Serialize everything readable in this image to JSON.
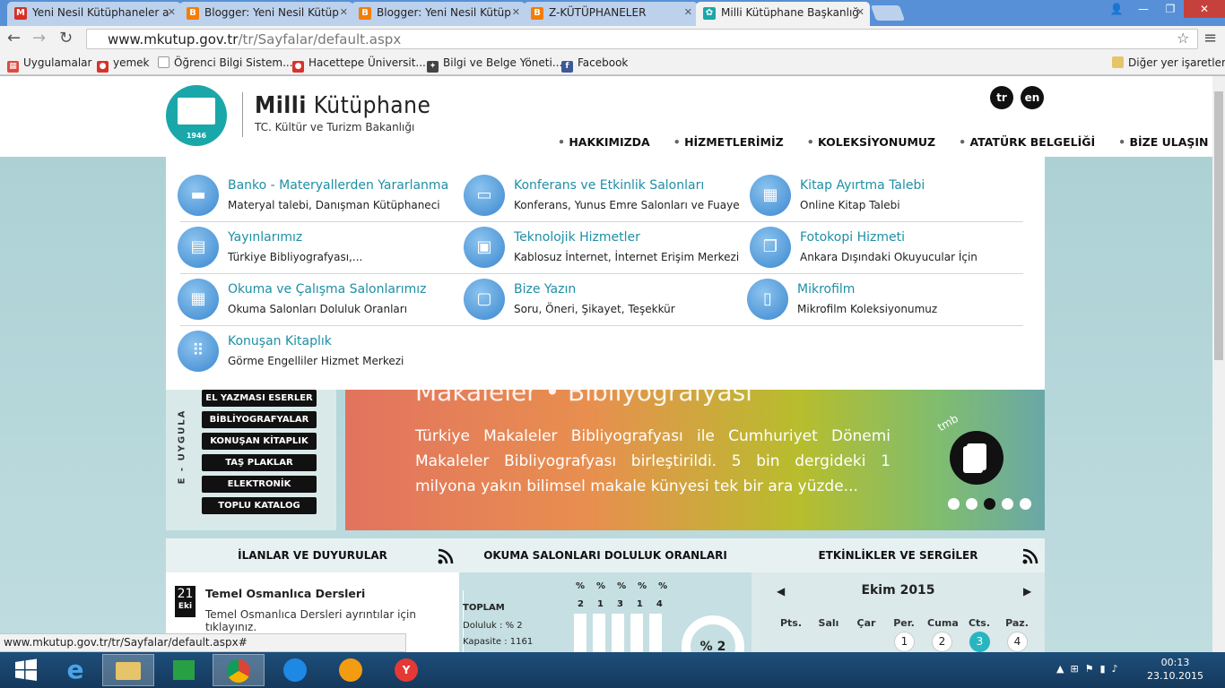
{
  "browser": {
    "tabs": [
      {
        "title": "Yeni Nesil Kütüphaneler a",
        "icon": "gmail-icon",
        "color": "#d93025"
      },
      {
        "title": "Blogger: Yeni Nesil Kütüp",
        "icon": "blogger-icon",
        "color": "#f57d00"
      },
      {
        "title": "Blogger: Yeni Nesil Kütüp",
        "icon": "blogger-icon",
        "color": "#f57d00"
      },
      {
        "title": "Z-KÜTÜPHANELER",
        "icon": "blogger-icon",
        "color": "#f57d00"
      },
      {
        "title": "Milli Kütüphane Başkanlığ",
        "icon": "mk-icon",
        "color": "#1aa7a9"
      }
    ],
    "url_domain": "www.mkutup.gov.tr",
    "url_path": "/tr/Sayfalar/default.aspx",
    "bookmarks": [
      {
        "label": "Uygulamalar",
        "icon": "apps-icon"
      },
      {
        "label": "yemek",
        "icon": "site-icon"
      },
      {
        "label": "Öğrenci Bilgi Sistem...",
        "icon": "page-icon"
      },
      {
        "label": "Hacettepe Üniversit...",
        "icon": "site-icon"
      },
      {
        "label": "Bilgi ve Belge Yöneti...",
        "icon": "site-icon"
      },
      {
        "label": "Facebook",
        "icon": "facebook-icon"
      }
    ],
    "other_bookmarks": "Diğer yer işaretleri",
    "status_url": "www.mkutup.gov.tr/tr/Sayfalar/default.aspx#"
  },
  "site": {
    "logo_year": "1946",
    "title_bold": "Milli",
    "title_rest": "Kütüphane",
    "subtitle": "TC. Kültür ve Turizm Bakanlığı",
    "langs": [
      "tr",
      "en"
    ],
    "nav": [
      "HAKKIMIZDA",
      "HİZMETLERİMİZ",
      "KOLEKSİYONUMUZ",
      "ATATÜRK BELGELİĞİ",
      "BİZE ULAŞIN"
    ]
  },
  "menu": [
    {
      "title": "Banko - Materyallerden Yararlanma",
      "sub": "Materyal talebi, Danışman Kütüphaneci",
      "icon": "desk-icon"
    },
    {
      "title": "Konferans ve Etkinlik Salonları",
      "sub": "Konferans, Yunus Emre Salonları ve Fuaye",
      "icon": "projector-icon"
    },
    {
      "title": "Kitap Ayırtma Talebi",
      "sub": "Online Kitap Talebi",
      "icon": "calendar-icon"
    },
    {
      "title": "Yayınlarımız",
      "sub": "Türkiye Bibliyografyası,...",
      "icon": "book-icon"
    },
    {
      "title": "Teknolojik Hizmetler",
      "sub": "Kablosuz İnternet, İnternet Erişim Merkezi",
      "icon": "computer-icon"
    },
    {
      "title": "Fotokopi Hizmeti",
      "sub": "Ankara Dışındaki Okuyucular İçin",
      "icon": "copy-icon"
    },
    {
      "title": "Okuma ve Çalışma Salonlarımız",
      "sub": "Okuma Salonları Doluluk Oranları",
      "icon": "grid-icon"
    },
    {
      "title": "Bize Yazın",
      "sub": "Soru, Öneri, Şikayet, Teşekkür",
      "icon": "message-icon"
    },
    {
      "title": "Mikrofilm",
      "sub": "Mikrofilm Koleksiyonumuz",
      "icon": "film-icon"
    },
    {
      "title": "Konuşan Kitaplık",
      "sub": "Görme Engelliler Hizmet Merkezi",
      "icon": "braille-icon"
    }
  ],
  "eapps": {
    "label": "E - UYGULA",
    "buttons": [
      "EL YAZMASI ESERLER",
      "BİBLİYOGRAFYALAR",
      "KONUŞAN KİTAPLIK",
      "TAŞ PLAKLAR",
      "ELEKTRONİK KAYNAKLAR",
      "TOPLU KATALOG"
    ]
  },
  "slider": {
    "heading": "Makaleler • Bibliyografyası",
    "text": "Türkiye Makaleler Bibliyografyası ile Cumhuriyet Dönemi Makaleler Bibliyografyası birleştirildi. 5 bin dergideki 1 milyona yakın bilimsel makale künyesi tek bir ara yüzde...",
    "badge": "tmb",
    "dots": 5,
    "active_dot": 3
  },
  "panels": {
    "announcements": {
      "title": "İLANLAR VE DUYURULAR",
      "day": "21",
      "month": "Eki",
      "item_title": "Temel Osmanlıca Dersleri",
      "item_text": "Temel Osmanlıca Dersleri ayrıntılar için tıklayınız."
    },
    "occupancy": {
      "title": "OKUMA SALONLARI DOLULUK ORANLARI",
      "total_label": "TOPLAM",
      "fill": "Doluluk : % 2",
      "capacity": "Kapasite : 1161",
      "percents": [
        "%",
        "%",
        "%",
        "%",
        "%"
      ],
      "values": [
        "2",
        "1",
        "3",
        "1",
        "4"
      ],
      "gauge": "% 2"
    },
    "events": {
      "title": "ETKİNLİKLER VE SERGİLER",
      "month": "Ekim 2015",
      "days": [
        "Pts.",
        "Salı",
        "Çar",
        "Per.",
        "Cuma",
        "Cts.",
        "Paz."
      ],
      "dates": [
        "1",
        "2",
        "3",
        "4"
      ],
      "today": "3"
    }
  },
  "taskbar": {
    "time": "00:13",
    "date": "23.10.2015"
  }
}
